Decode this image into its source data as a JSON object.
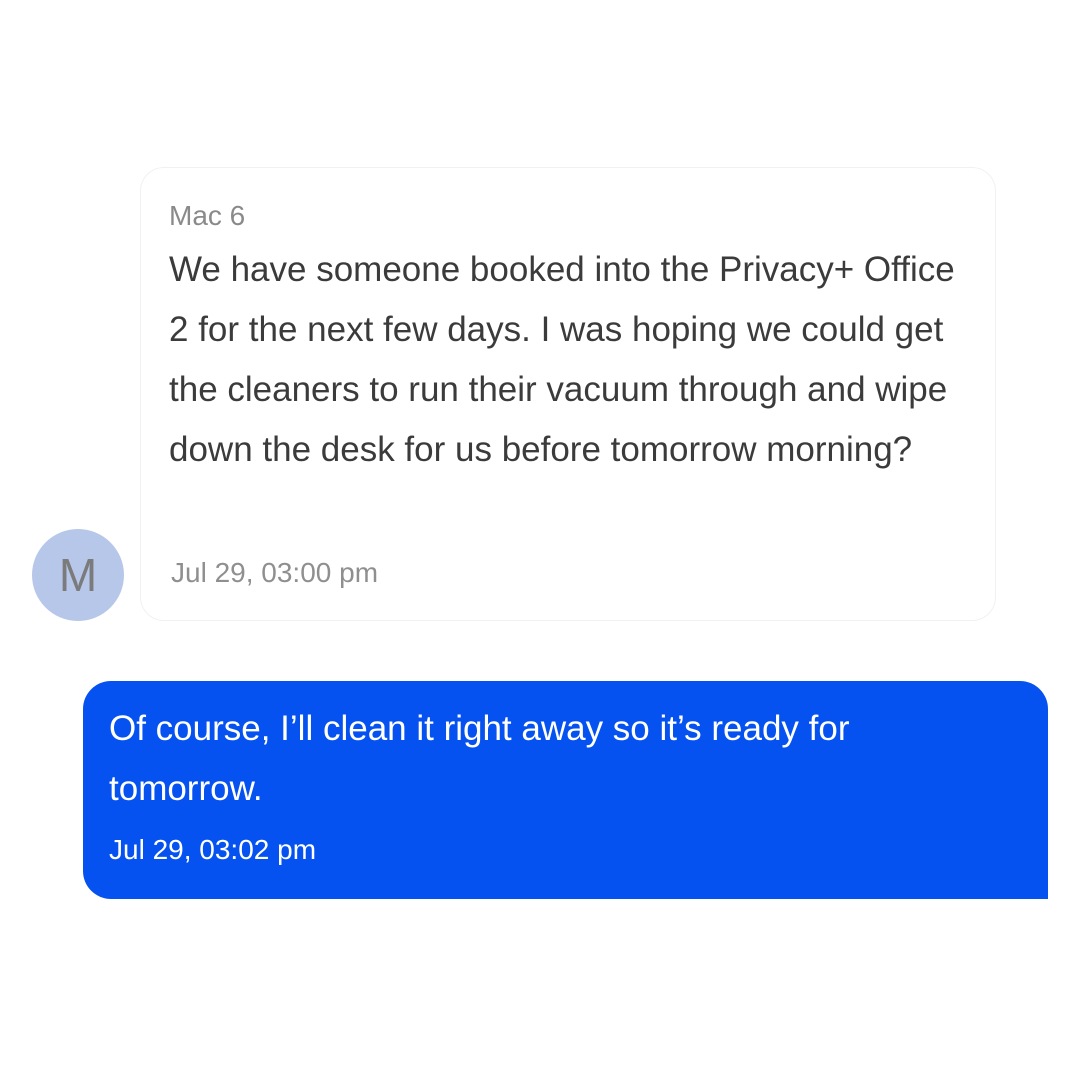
{
  "messages": {
    "incoming": {
      "sender": "Mac 6",
      "avatar_initial": "M",
      "text": "We have someone booked into the Privacy+ Office 2 for the next few days. I was hoping we could get the cleaners to run their vacuum through and wipe down the desk for us before tomorrow morning?",
      "timestamp": "Jul 29, 03:00 pm"
    },
    "outgoing": {
      "text": "Of course, I’ll clean it right away so it’s ready for tomorrow.",
      "timestamp": "Jul 29, 03:02 pm"
    }
  },
  "colors": {
    "outgoing_bubble": "#0652f0",
    "avatar_background": "#b7c7ea",
    "incoming_text": "#3b3b3b",
    "muted_text": "#8a8a8a"
  }
}
